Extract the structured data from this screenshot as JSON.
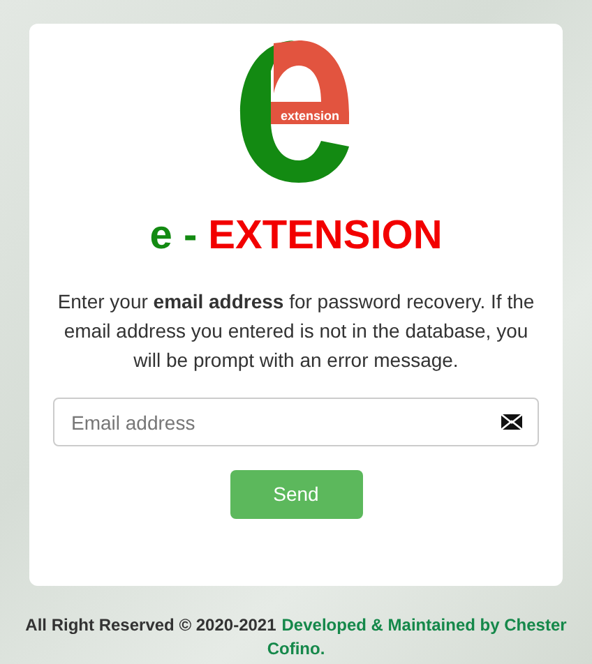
{
  "logo": {
    "text": "extension"
  },
  "title": {
    "prefix": "e",
    "separator": "-",
    "name": "EXTENSION"
  },
  "instructions": "Enter your **email address** for password recovery. If the email address you entered is not in the database, you will be prompt with an error message.",
  "email_field": {
    "placeholder": "Email address"
  },
  "send_button": "Send",
  "footer": {
    "copyright": "All Right Reserved © 2020-2021",
    "credit": [
      "Developed & Maintained by Chester",
      "Cofino."
    ]
  }
}
